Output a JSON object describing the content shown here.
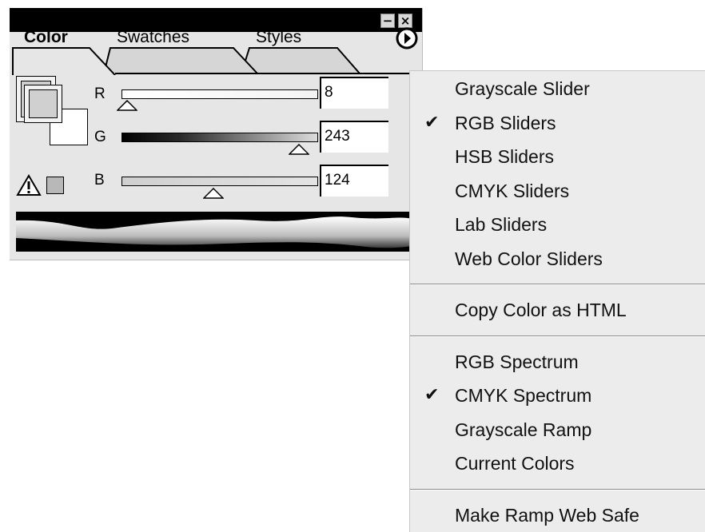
{
  "panel": {
    "tabs": [
      {
        "label": "Color",
        "active": true
      },
      {
        "label": "Swatches",
        "active": false
      },
      {
        "label": "Styles",
        "active": false
      }
    ],
    "window_buttons": {
      "minimize": "−",
      "close": "×"
    },
    "sliders": [
      {
        "letter": "R",
        "value": "8",
        "level": 0.03
      },
      {
        "letter": "G",
        "value": "243",
        "level": 0.95
      },
      {
        "letter": "B",
        "value": "124",
        "level": 0.49
      }
    ],
    "icons": {
      "gamut_warning": "warning-triangle-icon",
      "menu_button": "right-arrow-circle-icon"
    },
    "colors": {
      "title_bar": "#000000",
      "panel_bg": "#e6e6e6",
      "menu_bg": "#ececec"
    }
  },
  "menu": {
    "groups": [
      [
        {
          "label": "Grayscale Slider",
          "checked": false
        },
        {
          "label": "RGB Sliders",
          "checked": true
        },
        {
          "label": "HSB Sliders",
          "checked": false
        },
        {
          "label": "CMYK Sliders",
          "checked": false
        },
        {
          "label": "Lab Sliders",
          "checked": false
        },
        {
          "label": "Web Color Sliders",
          "checked": false
        }
      ],
      [
        {
          "label": "Copy Color as HTML",
          "checked": false
        }
      ],
      [
        {
          "label": "RGB Spectrum",
          "checked": false
        },
        {
          "label": "CMYK Spectrum",
          "checked": true
        },
        {
          "label": "Grayscale Ramp",
          "checked": false
        },
        {
          "label": "Current Colors",
          "checked": false
        }
      ],
      [
        {
          "label": "Make Ramp Web Safe",
          "checked": false
        }
      ]
    ],
    "check_glyph": "✔"
  }
}
